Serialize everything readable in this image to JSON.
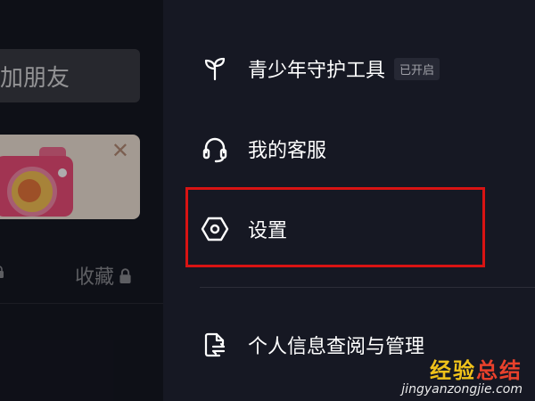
{
  "left_panel": {
    "add_friend_label": "加朋友",
    "favorites_label": "收藏"
  },
  "menu": {
    "items": [
      {
        "label": "青少年守护工具",
        "badge": "已开启",
        "icon": "sprout-icon"
      },
      {
        "label": "我的客服",
        "icon": "headset-icon"
      },
      {
        "label": "设置",
        "icon": "hexagon-settings-icon"
      },
      {
        "label": "个人信息查阅与管理",
        "icon": "document-exchange-icon"
      }
    ]
  },
  "watermark": {
    "title_parts": [
      "经",
      "验",
      "总",
      "结"
    ],
    "url": "jingyanzongjie.com"
  },
  "colors": {
    "background": "#161823",
    "highlight": "#d81313",
    "text": "#ffffff"
  }
}
